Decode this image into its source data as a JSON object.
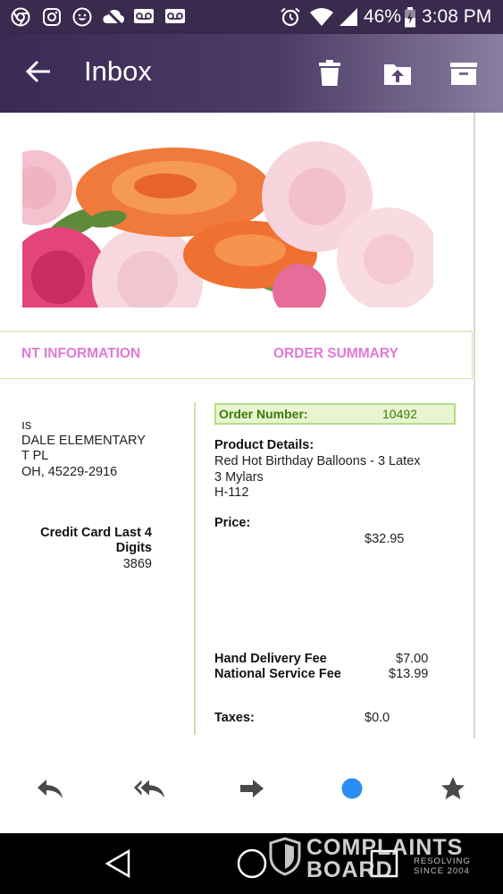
{
  "status_bar": {
    "battery": "46%",
    "time": "3:08 PM",
    "icons": [
      "chrome-icon",
      "instagram-icon",
      "emoji-icon",
      "cloud-off-icon",
      "voicemail-icon",
      "voicemail-icon",
      "alarm-icon",
      "wifi-icon",
      "signal-icon",
      "battery-icon"
    ]
  },
  "app_bar": {
    "title": "Inbox",
    "actions": [
      "delete-icon",
      "move-to-folder-icon",
      "archive-icon"
    ]
  },
  "email": {
    "tabs": {
      "left": "NT INFORMATION",
      "right": "ORDER SUMMARY"
    },
    "address_lines": [
      "ıs",
      "DALE ELEMENTARY",
      "T PL",
      "OH, 45229-2916"
    ],
    "credit_card": {
      "label_line1": "Credit Card Last 4",
      "label_line2": "Digits",
      "value": "3869"
    },
    "order": {
      "number_label": "Order Number:",
      "number_value": "10492",
      "product_label": "Product Details:",
      "product_lines": [
        "Red Hot Birthday Balloons - 3 Latex",
        "3 Mylars",
        "H-112"
      ],
      "price_label": "Price:",
      "price_value": "$32.95",
      "hand_delivery_label": "Hand Delivery Fee",
      "hand_delivery_value": "$7.00",
      "service_fee_label": "National Service Fee",
      "service_fee_value": "$13.99",
      "taxes_label": "Taxes:",
      "taxes_value": "$0.0"
    }
  },
  "action_bar": {
    "actions": [
      "reply-icon",
      "reply-all-icon",
      "forward-icon",
      "read-status-icon",
      "star-icon"
    ],
    "accent": "#2b8ef0"
  },
  "watermark": {
    "line1": "COMPLAINTS",
    "line2": "BOARD",
    "small1": "RESOLVING",
    "small2": "SINCE 2004"
  },
  "colors": {
    "app_bar_start": "#3b2a55",
    "tab_text": "#e079d6",
    "order_green": "#3a7a0c",
    "border_green": "#cfe0a6"
  }
}
